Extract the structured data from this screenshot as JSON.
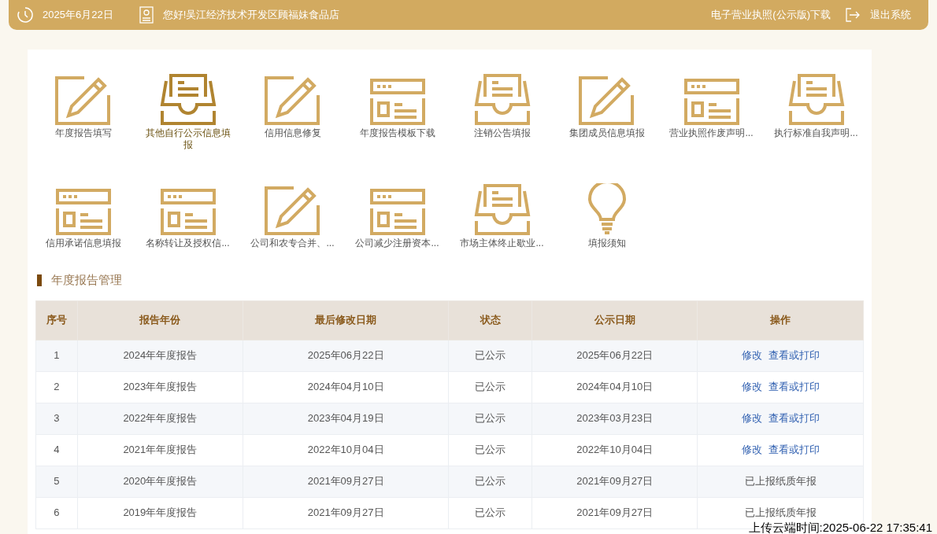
{
  "top_bar": {
    "date": "2025年6月22日",
    "greeting": "您好!吴江经济技术开发区顾福妹食品店",
    "license_download": "电子营业执照(公示版)下载",
    "logout": "退出系统"
  },
  "shortcuts": [
    {
      "label": "年度报告填写",
      "kind": "pencil",
      "selected": false
    },
    {
      "label": "其他自行公示信息填报",
      "kind": "tray",
      "selected": true
    },
    {
      "label": "信用信息修复",
      "kind": "pencil",
      "selected": false
    },
    {
      "label": "年度报告模板下载",
      "kind": "window",
      "selected": false
    },
    {
      "label": "注销公告填报",
      "kind": "tray",
      "selected": false
    },
    {
      "label": "集团成员信息填报",
      "kind": "pencil",
      "selected": false
    },
    {
      "label": "营业执照作废声明...",
      "kind": "window",
      "selected": false
    },
    {
      "label": "执行标准自我声明...",
      "kind": "tray",
      "selected": false
    },
    {
      "label": "信用承诺信息填报",
      "kind": "window",
      "selected": false
    },
    {
      "label": "名称转让及授权信...",
      "kind": "window",
      "selected": false
    },
    {
      "label": "公司和农专合并、...",
      "kind": "pencil",
      "selected": false
    },
    {
      "label": "公司减少注册资本...",
      "kind": "window",
      "selected": false
    },
    {
      "label": "市场主体终止歇业...",
      "kind": "tray",
      "selected": false
    },
    {
      "label": "填报须知",
      "kind": "bulb",
      "selected": false
    }
  ],
  "section_title": "年度报告管理",
  "table": {
    "columns": [
      "序号",
      "报告年份",
      "最后修改日期",
      "状态",
      "公示日期",
      "操作"
    ],
    "rows": [
      {
        "cells": [
          "1",
          "2024年年度报告",
          "2025年06月22日",
          "已公示",
          "2025年06月22日"
        ],
        "actions": [
          {
            "label": "修改",
            "kind": "link"
          },
          {
            "label": "查看或打印",
            "kind": "link"
          }
        ]
      },
      {
        "cells": [
          "2",
          "2023年年度报告",
          "2024年04月10日",
          "已公示",
          "2024年04月10日"
        ],
        "actions": [
          {
            "label": "修改",
            "kind": "link"
          },
          {
            "label": "查看或打印",
            "kind": "link"
          }
        ]
      },
      {
        "cells": [
          "3",
          "2022年年度报告",
          "2023年04月19日",
          "已公示",
          "2023年03月23日"
        ],
        "actions": [
          {
            "label": "修改",
            "kind": "link"
          },
          {
            "label": "查看或打印",
            "kind": "link"
          }
        ]
      },
      {
        "cells": [
          "4",
          "2021年年度报告",
          "2022年10月04日",
          "已公示",
          "2022年10月04日"
        ],
        "actions": [
          {
            "label": "修改",
            "kind": "link"
          },
          {
            "label": "查看或打印",
            "kind": "link"
          }
        ]
      },
      {
        "cells": [
          "5",
          "2020年年度报告",
          "2021年09月27日",
          "已公示",
          "2021年09月27日"
        ],
        "actions": [
          {
            "label": "已上报纸质年报",
            "kind": "text"
          }
        ]
      },
      {
        "cells": [
          "6",
          "2019年年度报告",
          "2021年09月27日",
          "已公示",
          "2021年09月27日"
        ],
        "actions": [
          {
            "label": "已上报纸质年报",
            "kind": "text"
          }
        ]
      }
    ]
  },
  "upload_stamp": "上传云端时间:2025-06-22 17:35:41"
}
